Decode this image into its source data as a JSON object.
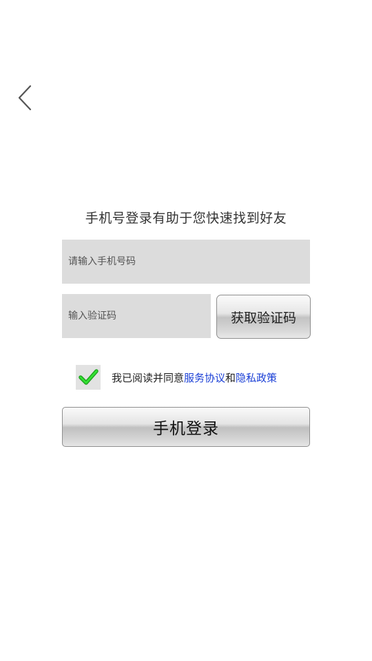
{
  "header": {
    "back_icon": "chevron-left-icon"
  },
  "subtitle": "手机号登录有助于您快速找到好友",
  "phone_input": {
    "placeholder": "请输入手机号码",
    "value": ""
  },
  "code_input": {
    "placeholder": "输入验证码",
    "value": ""
  },
  "get_code_button": {
    "label": "获取验证码"
  },
  "agreement": {
    "checked": true,
    "check_icon": "checkmark-icon",
    "check_color": "#22cc22",
    "prefix": "我已阅读并同意",
    "service_link": "服务协议",
    "joiner": "和",
    "privacy_link": "隐私政策",
    "link_color": "#1a3fd6"
  },
  "login_button": {
    "label": "手机登录"
  }
}
